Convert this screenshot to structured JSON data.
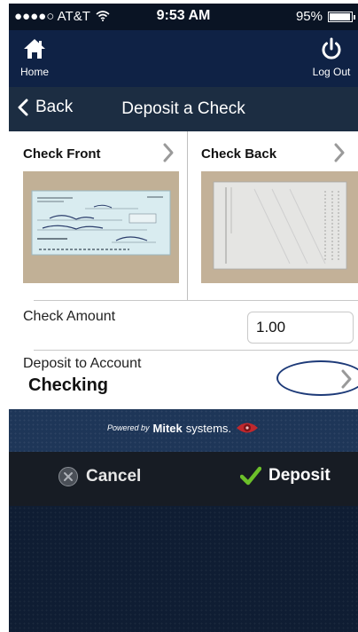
{
  "status_bar": {
    "carrier": "●●●●○ AT&T",
    "time": "9:53 AM",
    "battery": "95%"
  },
  "top_nav": {
    "home_label": "Home",
    "logout_label": "Log Out",
    "home_icon": "home-icon",
    "logout_icon": "power-icon"
  },
  "header": {
    "back_label": "Back",
    "title": "Deposit a Check"
  },
  "checks": {
    "front_label": "Check Front",
    "back_label": "Check Back"
  },
  "form": {
    "amount_label": "Check Amount",
    "amount_value": "1.00",
    "account_label": "Deposit to Account",
    "account_value": "Checking"
  },
  "powered": {
    "powered_by": "Powered by",
    "brand_strong": "Mitek",
    "brand_light": "systems."
  },
  "actions": {
    "cancel_label": "Cancel",
    "deposit_label": "Deposit"
  },
  "colors": {
    "nav_bg": "#0f2245",
    "title_bg": "#1c2d42",
    "deposit_check": "#6cc02a",
    "oval_border": "#1d3a78"
  }
}
